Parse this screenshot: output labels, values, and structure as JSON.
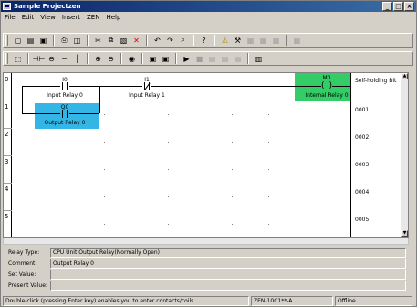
{
  "window": {
    "title": "Sample Projectzen",
    "controls": [
      "_",
      "□",
      "×"
    ]
  },
  "menu": [
    "File",
    "Edit",
    "View",
    "Insert",
    "ZEN",
    "Help"
  ],
  "toolbar1": {
    "icons": [
      "new-icon",
      "open-icon",
      "save-icon",
      "print-icon",
      "print-preview-icon",
      "cut-icon",
      "copy-icon",
      "paste-icon",
      "delete-icon",
      "undo-icon",
      "redo-icon",
      "find-icon",
      "help-icon",
      "warning-icon",
      "tool-icon",
      "grid-icon",
      "grid-icon",
      "grid-icon",
      "grid-icon"
    ]
  },
  "toolbar2": {
    "icons": [
      "select-icon",
      "contact-icon",
      "coil-icon",
      "line-icon",
      "zoom-in-icon",
      "zoom-out-icon",
      "monitor-icon",
      "view-icon",
      "view-icon",
      "run-icon",
      "stop-icon",
      "panel-icon",
      "panel-icon",
      "panel-icon",
      "chart-icon"
    ]
  },
  "ladder": {
    "row_numbers": [
      "0",
      "1",
      "2",
      "3",
      "4",
      "5"
    ],
    "contacts": [
      {
        "address": "I0",
        "label": "Input Relay 0",
        "type": "no"
      },
      {
        "address": "I1",
        "label": "Input Relay 1",
        "type": "nc"
      },
      {
        "address": "Q0",
        "label": "Output Relay 0",
        "type": "no"
      }
    ],
    "coil": {
      "address": "M0",
      "label": "Internal Relay 0"
    },
    "comment_column": {
      "header": "Self-holding Bit",
      "rows": [
        "0001",
        "0002",
        "0003",
        "0004",
        "0005"
      ]
    },
    "selected_color": "#33b6e6",
    "output_color": "#33cc66"
  },
  "properties": {
    "relay_type_label": "Relay Type:",
    "relay_type_value": "CPU Unit Output Relay(Normally Open)",
    "comment_label": "Comment:",
    "comment_value": "Output Relay 0",
    "set_value_label": "Set Value:",
    "set_value_value": "",
    "present_value_label": "Present Value:",
    "present_value_value": ""
  },
  "status": {
    "hint": "Double-click (pressing Enter key) enables you to enter contacts/coils.",
    "model": "ZEN-10C1**-A",
    "mode": "Offline"
  }
}
